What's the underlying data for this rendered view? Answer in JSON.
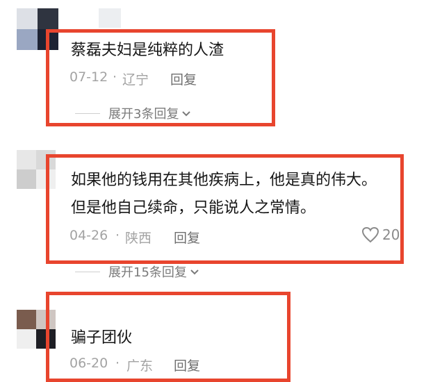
{
  "accent_color": "#e8452e",
  "comments": [
    {
      "text_lines": [
        "蔡磊夫妇是纯粹的人渣"
      ],
      "date": "07-12",
      "separator": "·",
      "location": "辽宁",
      "reply_label": "回复",
      "expand_label": "展开3条回复"
    },
    {
      "text_lines": [
        "如果他的钱用在其他疾病上，他是真的伟大。",
        "但是他自己续命，只能说人之常情。"
      ],
      "date": "04-26",
      "separator": "·",
      "location": "陕西",
      "reply_label": "回复",
      "like_count": "20",
      "like_icon": "heart-outline-icon",
      "expand_label": "展开15条回复"
    },
    {
      "text_lines": [
        "骗子团伙"
      ],
      "date": "06-20",
      "separator": "·",
      "location": "广东",
      "reply_label": "回复"
    }
  ]
}
